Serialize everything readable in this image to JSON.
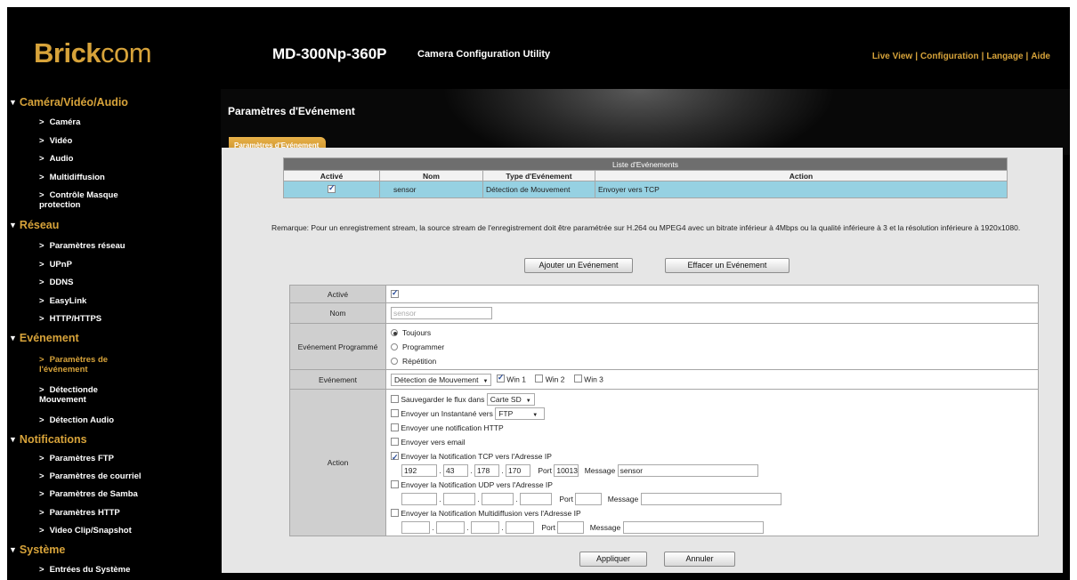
{
  "header": {
    "logo_bold": "Brick",
    "logo_light": "com",
    "model": "MD-300Np-360P",
    "subtitle": "Camera Configuration Utility",
    "nav": [
      "Live View",
      "Configuration",
      "Langage",
      "Aide"
    ]
  },
  "sidebar": {
    "sections": [
      {
        "label": "Caméra/Vidéo/Audio",
        "items": [
          "Caméra",
          "Vidéo",
          "Audio",
          "Multidiffusion",
          "Contrôle Masque protection"
        ]
      },
      {
        "label": "Réseau",
        "items": [
          "Paramètres réseau",
          "UPnP",
          "DDNS",
          "EasyLink",
          "HTTP/HTTPS"
        ]
      },
      {
        "label": "Evénement",
        "items": [
          "Paramètres de l'événement",
          "Détectionde Mouvement",
          "Détection Audio"
        ]
      },
      {
        "label": "Notifications",
        "items": [
          "Paramètres FTP",
          "Paramètres de courriel",
          "Paramètres de Samba",
          "Paramètres HTTP",
          "Video Clip/Snapshot"
        ]
      },
      {
        "label": "Système",
        "items": [
          "Entrées du Système"
        ]
      }
    ],
    "active_item": "Paramètres de l'événement"
  },
  "main": {
    "page_title": "Paramètres d'Evénement",
    "tab_label": "Paramètres d'Evénement",
    "event_list": {
      "caption": "Liste d'Evénements",
      "columns": [
        "Activé",
        "Nom",
        "Type d'Evénement",
        "Action"
      ],
      "rows": [
        {
          "enabled": true,
          "name": "sensor",
          "type": "Détection de Mouvement",
          "action": "Envoyer vers TCP"
        }
      ]
    },
    "remark": "Remarque: Pour un enregistrement stream, la source stream de l'enregistrement doit être paramétrée sur H.264 ou MPEG4 avec un bitrate inférieur à 4Mbps ou la qualité inférieure à 3 et la résolution inférieure à 1920x1080.",
    "add_button": "Ajouter un Evénement",
    "delete_button": "Effacer un Evénement",
    "form": {
      "enabled_label": "Activé",
      "name_label": "Nom",
      "name_placeholder": "sensor",
      "schedule_label": "Evénement Programmé",
      "schedule_options": [
        "Toujours",
        "Programmer",
        "Répétition"
      ],
      "event_label": "Evénement",
      "event_select": "Détection de Mouvement",
      "windows": [
        "Win 1",
        "Win 2",
        "Win 3"
      ],
      "action_label": "Action",
      "save_stream": "Sauvegarder le flux dans",
      "save_stream_target": "Carte SD",
      "send_snapshot": "Envoyer un Instantané vers",
      "send_snapshot_target": "FTP",
      "send_http": "Envoyer une notification HTTP",
      "send_email": "Envoyer vers email",
      "send_tcp": "Envoyer la Notification TCP vers l'Adresse IP",
      "tcp_ip": [
        "192",
        "43",
        "178",
        "170"
      ],
      "port_label": "Port",
      "tcp_port": "10013",
      "message_label": "Message",
      "tcp_message": "sensor",
      "send_udp": "Envoyer la Notification UDP vers l'Adresse IP",
      "send_multicast": "Envoyer la Notification Multidiffusion vers l'Adresse IP"
    },
    "apply_button": "Appliquer",
    "cancel_button": "Annuler"
  }
}
